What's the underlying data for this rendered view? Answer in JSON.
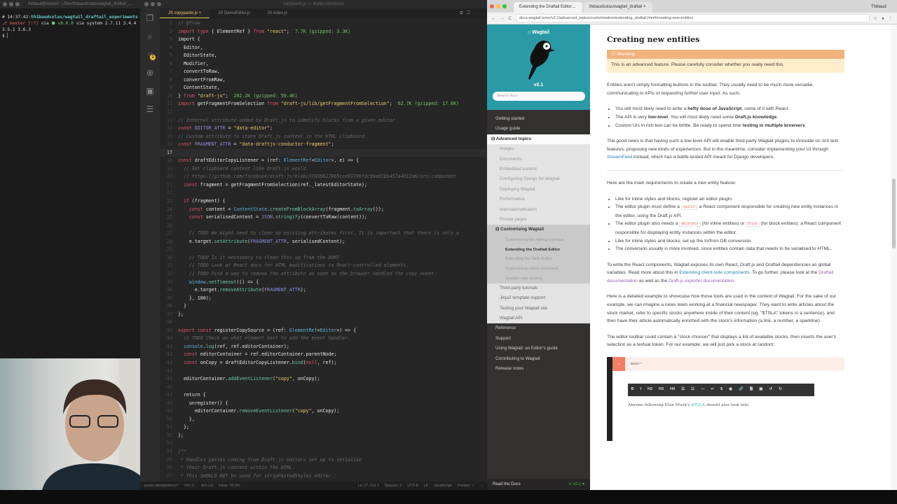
{
  "terminal": {
    "title": "thibaud@lokood: ~/Dev/thibaudcolas/wagtail_draftail_...",
    "time": "14:37:42",
    "path": "thibaudcolas/wagtail_draftail_experiments",
    "branch": "master [!?]",
    "node": "v8.6.0",
    "python": "system 2.7.11 3.4.4 3.5.1 3.6.3",
    "prompt": "$"
  },
  "editor": {
    "window_title": "copypaste.js — draftjs-conductor",
    "activity_icons": [
      "files-icon",
      "search-icon",
      "source-control-icon",
      "extensions-icon",
      "remote-icon",
      "outline-icon"
    ],
    "scm_badge": "1",
    "tabs": [
      {
        "label": "JS copypaste.js",
        "close": "×"
      },
      {
        "label": "JS DemoEditor.js"
      },
      {
        "label": "JS index.js"
      }
    ],
    "current_line": 17,
    "lines": [
      {
        "n": 1,
        "t": "// @flow",
        "c": 1
      },
      {
        "n": 2,
        "t": "import type { ElementRef } from \"react\";  7.7K (gzipped: 3.3K)"
      },
      {
        "n": 3,
        "t": "import {"
      },
      {
        "n": 4,
        "t": "  Editor,"
      },
      {
        "n": 5,
        "t": "  EditorState,"
      },
      {
        "n": 6,
        "t": "  Modifier,"
      },
      {
        "n": 7,
        "t": "  convertToRaw,"
      },
      {
        "n": 8,
        "t": "  convertFromRaw,"
      },
      {
        "n": 9,
        "t": "  ContentState,"
      },
      {
        "n": 10,
        "t": "} from \"draft-js\";  202.2K (gzipped: 59.4K)"
      },
      {
        "n": 11,
        "t": "import getFragmentFromSelection from \"draft-js/lib/getFragmentFromSelection\";  62.7K (gzipped: 17.6K)"
      },
      {
        "n": 12,
        "t": ""
      },
      {
        "n": 13,
        "t": "// Internal attribute added by Draft.js to identify blocks from a given editor.",
        "c": 1
      },
      {
        "n": 14,
        "t": "const EDITOR_ATTR = \"data-editor\";"
      },
      {
        "n": 15,
        "t": "// Custom attribute to store Draft.js content in the HTML clipboard.",
        "c": 1
      },
      {
        "n": 16,
        "t": "const FRAGMENT_ATTR = \"data-draftjs-conductor-fragment\";"
      },
      {
        "n": 17,
        "t": ""
      },
      {
        "n": 18,
        "t": "const draftEditorCopyListener = (ref: ElementRef<Editor>, e) => {"
      },
      {
        "n": 19,
        "t": "  // Get clipboard content like Draft.js would.",
        "c": 1
      },
      {
        "n": 20,
        "t": "  // https://github.com/facebook/draft-js/blob/37989827065cce83796fdc99a81bb457a4812a6/src/component",
        "c": 1
      },
      {
        "n": 21,
        "t": "  const fragment = getFragmentFromSelection(ref._latestEditorState);"
      },
      {
        "n": 22,
        "t": ""
      },
      {
        "n": 23,
        "t": "  if (fragment) {"
      },
      {
        "n": 24,
        "t": "    const content = ContentState.createFromBlockArray(fragment.toArray());"
      },
      {
        "n": 25,
        "t": "    const serialisedContent = JSON.stringify(convertToRaw(content));"
      },
      {
        "n": 26,
        "t": ""
      },
      {
        "n": 27,
        "t": "    // TODO We might need to clean up existing attributes first. It is important that there is only o",
        "c": 1
      },
      {
        "n": 28,
        "t": "    e.target.setAttribute(FRAGMENT_ATTR, serialisedContent);"
      },
      {
        "n": 29,
        "t": ""
      },
      {
        "n": 30,
        "t": "    // TODO Is it necessary to clean this up from the DOM?",
        "c": 1
      },
      {
        "n": 31,
        "t": "    // TODO Look at React docs for HTML modifications to React-controlled elements.",
        "c": 1
      },
      {
        "n": 32,
        "t": "    // TODO Find a way to remove the attribute as soon as the browser handled the copy event.",
        "c": 1
      },
      {
        "n": 33,
        "t": "    window.setTimeout(() => {"
      },
      {
        "n": 34,
        "t": "      e.target.removeAttribute(FRAGMENT_ATTR);"
      },
      {
        "n": 35,
        "t": "    }, 100);"
      },
      {
        "n": 36,
        "t": "  }"
      },
      {
        "n": 37,
        "t": "};"
      },
      {
        "n": 38,
        "t": ""
      },
      {
        "n": 39,
        "t": "export const registerCopySource = (ref: ElementRef<Editor>) => {"
      },
      {
        "n": 40,
        "t": "  // TODO Check on what element best to add the event handler.",
        "c": 1
      },
      {
        "n": 41,
        "t": "  console.log(ref, ref.editorContainer);"
      },
      {
        "n": 42,
        "t": "  const editorContainer = ref.editorContainer.parentNode;"
      },
      {
        "n": 43,
        "t": "  const onCopy = draftEditorCopyListener.bind(null, ref);"
      },
      {
        "n": 44,
        "t": ""
      },
      {
        "n": 45,
        "t": "  editorContainer.addEventListener(\"copy\", onCopy);"
      },
      {
        "n": 46,
        "t": ""
      },
      {
        "n": 47,
        "t": "  return {"
      },
      {
        "n": 48,
        "t": "    unregister() {"
      },
      {
        "n": 49,
        "t": "      editorContainer.removeEventListener(\"copy\", onCopy);"
      },
      {
        "n": 50,
        "t": "    },"
      },
      {
        "n": 51,
        "t": "  };"
      },
      {
        "n": 52,
        "t": "};"
      },
      {
        "n": 53,
        "t": ""
      },
      {
        "n": 54,
        "t": "/**",
        "c": 1
      },
      {
        "n": 55,
        "t": " * Handles pastes coming from Draft.js editors set up to serialise",
        "c": 1
      },
      {
        "n": 56,
        "t": " * their Draft.js content within the HTML.",
        "c": 1
      },
      {
        "n": 57,
        "t": " * This SHOULD NOT be used for stripPastedStyles editor.",
        "c": 1
      }
    ],
    "status": {
      "branch": "paste-idempotence*",
      "sync": "⟳0↓1↑",
      "problems": "⊗0 ⚠0",
      "flow": "Flow: 78.3%",
      "position": "Ln 17, Col 1",
      "spaces": "Spaces: 2",
      "encoding": "UTF-8",
      "eol": "LF",
      "language": "JavaScript",
      "formatter": "Prettier: ✓"
    }
  },
  "browser": {
    "tabs": [
      "Extending the Draftail Editor — ×",
      "thibaudcolas/wagtail_draftail ×"
    ],
    "profile": "Thibaud",
    "url": "docs.wagtail.io/en/v2.1/advanced_topics/customisation/extending_draftail.html#creating-new-entities",
    "sidebar": {
      "brand": "Wagtail",
      "version": "v2.1",
      "search_placeholder": "Search docs",
      "items": [
        {
          "label": "Getting started",
          "level": "l1"
        },
        {
          "label": "Usage guide",
          "level": "l1"
        },
        {
          "label": "⊟ Advanced topics",
          "level": "l1open"
        },
        {
          "label": "Images",
          "level": "l2"
        },
        {
          "label": "Documents",
          "level": "l2"
        },
        {
          "label": "Embedded content",
          "level": "l2"
        },
        {
          "label": "Configuring Django for Wagtail",
          "level": "l2"
        },
        {
          "label": "Deploying Wagtail",
          "level": "l2"
        },
        {
          "label": "Performance",
          "level": "l2"
        },
        {
          "label": "Internationalisation",
          "level": "l2"
        },
        {
          "label": "Private pages",
          "level": "l2"
        },
        {
          "label": "⊟ Customising Wagtail",
          "level": "l2open"
        },
        {
          "label": "Customising the editing interface",
          "level": "l3"
        },
        {
          "label": "Extending the Draftail Editor",
          "level": "l3 cur"
        },
        {
          "label": "Extending the Hallo Editor",
          "level": "l3"
        },
        {
          "label": "Customising admin templates",
          "level": "l3"
        },
        {
          "label": "Custom user models",
          "level": "l3"
        },
        {
          "label": "Third-party tutorials",
          "level": "l2b"
        },
        {
          "label": "Jinja2 template support",
          "level": "l2b"
        },
        {
          "label": "Testing your Wagtail site",
          "level": "l2b"
        },
        {
          "label": "Wagtail API",
          "level": "l2b"
        },
        {
          "label": "Reference",
          "level": "l1"
        },
        {
          "label": "Support",
          "level": "l1"
        },
        {
          "label": "Using Wagtail: an Editor's guide",
          "level": "l1"
        },
        {
          "label": "Contributing to Wagtail",
          "level": "l1"
        },
        {
          "label": "Release notes",
          "level": "l1"
        }
      ],
      "rtd": "Read the Docs",
      "rtd_version": "v: v2.1 ▾"
    },
    "content": {
      "title": "Creating new entities",
      "warning_title": "Warning",
      "warning_text": "This is an advanced feature. Please carefully consider whether you really need this.",
      "p1": "Entities aren't simply formatting buttons in the toolbar. They usually need to be much more versatile, communicating to APIs or requesting further user input. As such,",
      "b1": {
        "a": "You will most likely need to write a ",
        "b": "hefty dose of JavaScript",
        "c": ", some of it with React."
      },
      "b2": {
        "a": "The API is very ",
        "b": "low-level",
        "c": ". You will most likely need some ",
        "d": "Draft.js knowledge",
        "e": "."
      },
      "b3": {
        "a": "Custom UIs in rich text can be brittle. Be ready to spend time ",
        "b": "testing in multiple browsers",
        "c": "."
      },
      "p2": {
        "a": "The good news is that having such a low-level API will enable third-party Wagtail plugins to innovate on rich text features, proposing new kinds of experiences. But in the meantime, consider implementing your UI through ",
        "link": "StreamField",
        "b": " instead, which has a battle-tested API meant for Django developers."
      },
      "p3": "Here are the main requirements to create a new entity feature:",
      "r1": "Like for inline styles and blocks, register an editor plugin.",
      "r2": {
        "a": "The editor plugin must define a ",
        "code": "source",
        "b": ": a React component responsible for creating new entity instances in the editor, using the Draft.js API."
      },
      "r3": {
        "a": "The editor plugin also needs a ",
        "code1": "decorator",
        "b": " (for inline entities) or ",
        "code2": "block",
        "c": " (for block entities): a React component responsible for displaying entity instances within the editor."
      },
      "r4": "Like for inline styles and blocks, set up the to/from DB conversion.",
      "r5": "The conversion usually is more involved, since entities contain data that needs to be serialised to HTML.",
      "p4": {
        "a": "To write the React components, Wagtail exposes its own React, Draft.js and Draftail dependencies as global variables. Read more about this in ",
        "l1": "Extending client-side components",
        "b": ". To go further, please look at the ",
        "l2": "Draftail documentation",
        "c": " as well as the ",
        "l3": "Draft.js exporter documentation",
        "d": "."
      },
      "p5": "Here is a detailed example to showcase how those tools are used in the context of Wagtail. For the sake of our example, we can imagine a news team working at a financial newspaper. They want to write articles about the stock market, refer to specific stocks anywhere inside of their content (eg. \"$TSLA\" tokens in a sentence), and then have their article automatically enriched with the stock's information (a link, a number, a sparkline).",
      "p6": "The editor toolbar could contain a \"stock chooser\" that displays a list of available stocks, then inserts the user's selection as a textual token. For our example, we will just pick a stock at random:",
      "demo": {
        "field": "BODY *",
        "toolbar": [
          "B",
          "I",
          "H2",
          "H3",
          "H4",
          "☰",
          "☷",
          "—",
          "↵",
          "$",
          "◉",
          "🔗",
          "🗎",
          "▣",
          "↺",
          "↻"
        ],
        "text_a": "Anyone following Elon Musk's ",
        "token": "$TSLA",
        "text_b": " should also look into"
      }
    }
  }
}
